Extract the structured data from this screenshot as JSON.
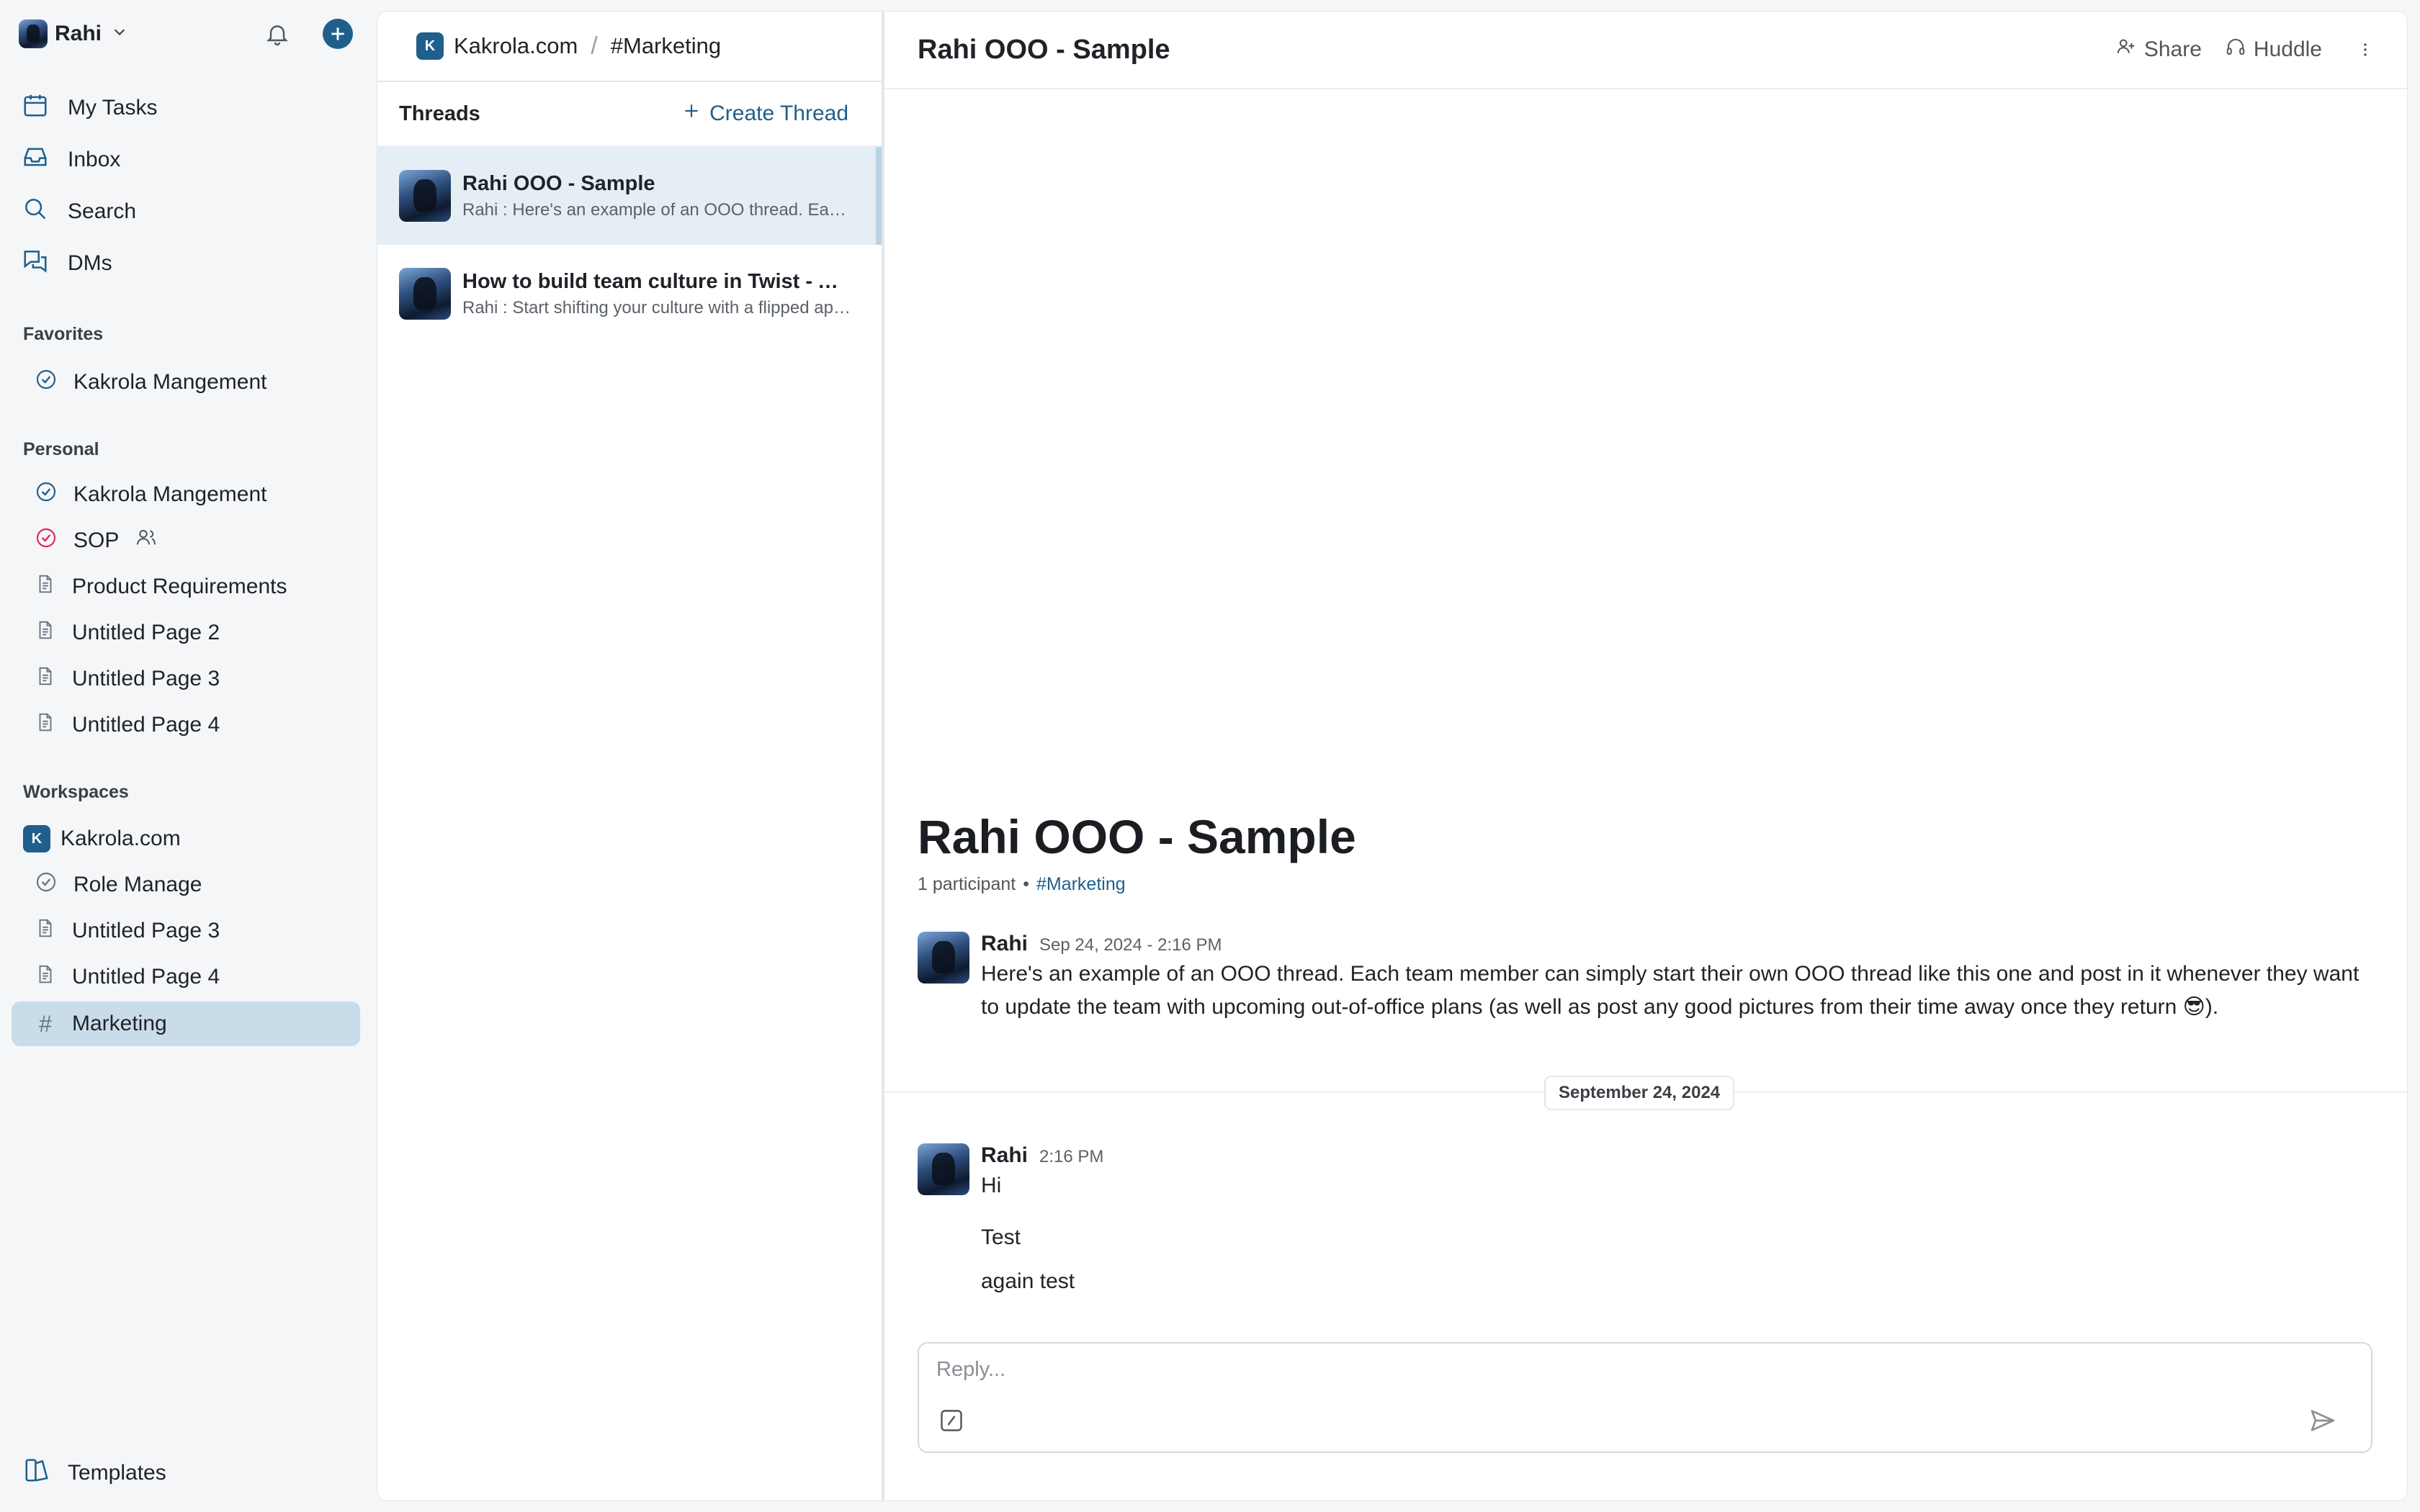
{
  "user": {
    "name": "Rahi"
  },
  "nav": [
    {
      "label": "My Tasks",
      "icon": "calendar-icon"
    },
    {
      "label": "Inbox",
      "icon": "inbox-icon"
    },
    {
      "label": "Search",
      "icon": "search-icon"
    },
    {
      "label": "DMs",
      "icon": "dms-icon"
    }
  ],
  "favorites": {
    "label": "Favorites",
    "items": [
      {
        "label": "Kakrola Mangement",
        "icon": "task-check-icon"
      }
    ]
  },
  "personal": {
    "label": "Personal",
    "items": [
      {
        "label": "Kakrola Mangement",
        "icon": "task-check-icon"
      },
      {
        "label": "SOP",
        "icon": "task-check-icon"
      },
      {
        "label": "Product Requirements",
        "icon": "page-icon"
      },
      {
        "label": "Untitled Page 2",
        "icon": "page-icon"
      },
      {
        "label": "Untitled Page 3",
        "icon": "page-icon"
      },
      {
        "label": "Untitled Page 4",
        "icon": "page-icon"
      }
    ]
  },
  "workspaces": {
    "label": "Workspaces",
    "workspace": {
      "badge": "K",
      "label": "Kakrola.com"
    },
    "items": [
      {
        "label": "Role Manage",
        "icon": "task-check-icon"
      },
      {
        "label": "Untitled Page 3",
        "icon": "page-icon"
      },
      {
        "label": "Untitled Page 4",
        "icon": "page-icon"
      },
      {
        "label": "Marketing",
        "icon": "hash-icon"
      }
    ]
  },
  "templates": {
    "label": "Templates"
  },
  "breadcrumb": {
    "badge": "K",
    "workspace": "Kakrola.com",
    "separator": "/",
    "channel": "#Marketing"
  },
  "threads": {
    "title": "Threads",
    "create_label": "Create Thread",
    "items": [
      {
        "title": "Rahi OOO - Sample",
        "preview": "Rahi : Here's an example of an OOO thread. Each team member can simply start"
      },
      {
        "title": "How to build team culture in Twist - A guide",
        "preview": "Rahi : Start shifting your culture with a flipped approach to communication"
      }
    ]
  },
  "main": {
    "header_title": "Rahi OOO - Sample",
    "share_label": "Share",
    "huddle_label": "Huddle",
    "big_title": "Rahi OOO - Sample",
    "participants": "1 participant",
    "bullet": "•",
    "channel": "#Marketing",
    "messages": [
      {
        "author": "Rahi",
        "time": "Sep 24, 2024 - 2:16 PM",
        "text": "Here's an example of an OOO thread. Each team member can simply start their own OOO thread like this one and post in it whenever they want to update the team with upcoming out-of-office plans (as well as post any good pictures from their time away once they return 😎)."
      },
      {
        "author": "Rahi",
        "time": "2:16 PM",
        "text": "Hi"
      }
    ],
    "date_divider": "September 24, 2024",
    "follow_ups": [
      "Test",
      "again test"
    ],
    "composer_placeholder": "Reply..."
  },
  "colors": {
    "accent": "#1f5f8b",
    "active_bg": "#c8dce9",
    "sop_icon": "#e0245e"
  }
}
